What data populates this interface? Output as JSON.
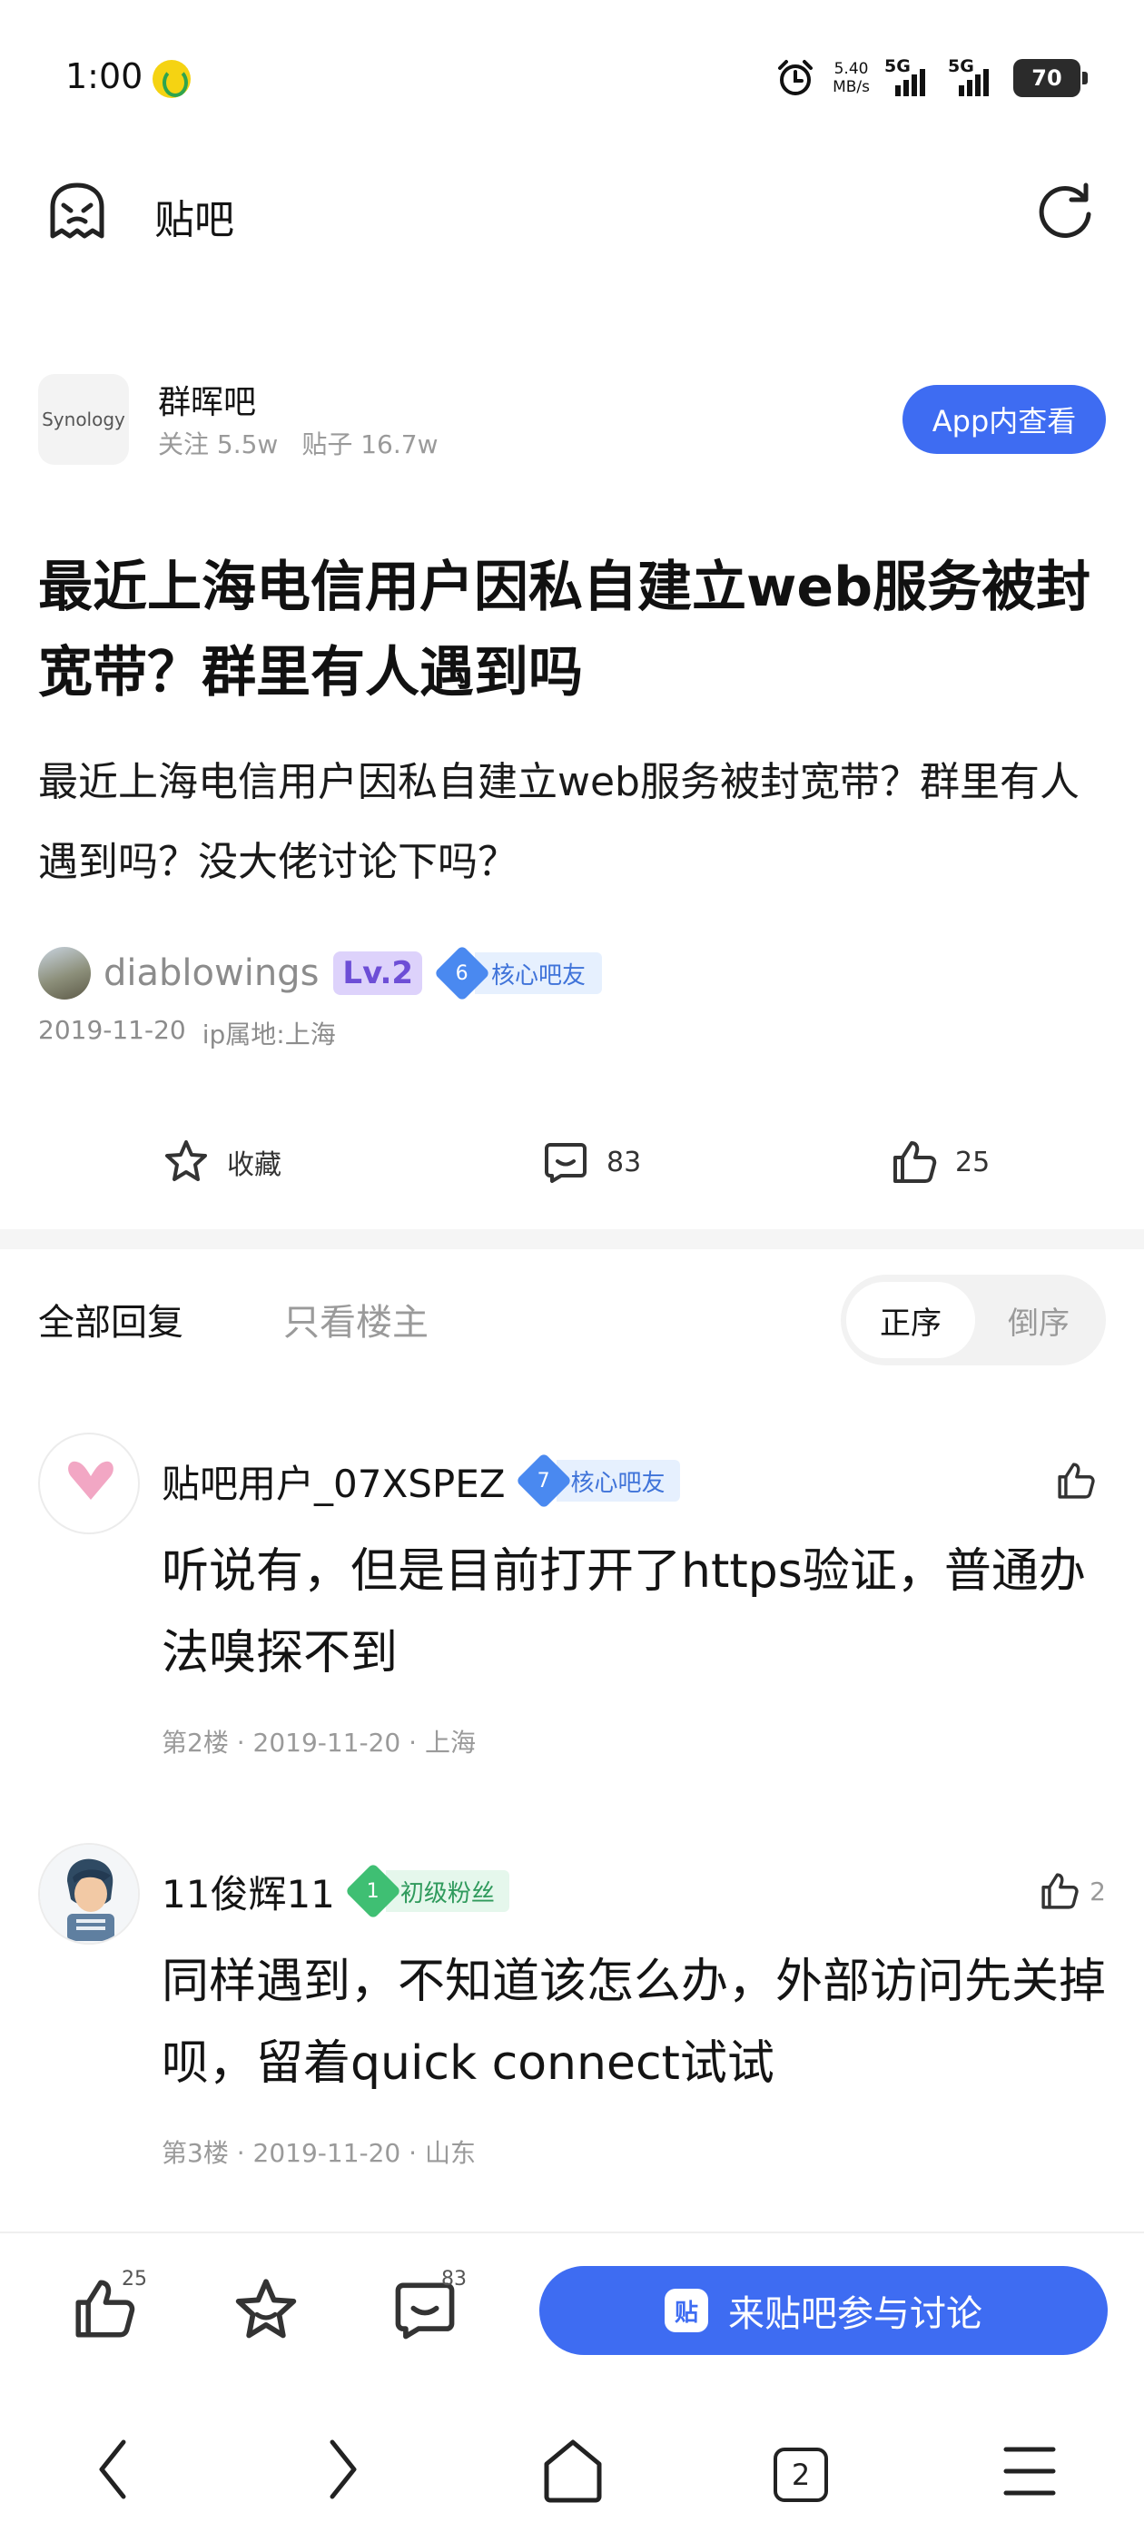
{
  "status_bar": {
    "time": "1:00",
    "speed_value": "5.40",
    "speed_unit": "MB/s",
    "net1": "5G",
    "net2": "5G",
    "battery": "70"
  },
  "header": {
    "title": "贴吧"
  },
  "forum": {
    "logo_text": "Synology",
    "name": "群晖吧",
    "followers": "关注 5.5w",
    "posts": "贴子 16.7w",
    "app_button": "App内查看"
  },
  "post": {
    "title": "最近上海电信用户因私自建立web服务被封宽带？群里有人遇到吗",
    "body": "最近上海电信用户因私自建立web服务被封宽带？群里有人遇到吗？没大佬讨论下吗？",
    "author": {
      "name": "diablowings",
      "level": "Lv.2",
      "badge_level": "6",
      "badge_text": "核心吧友"
    },
    "date": "2019-11-20",
    "location": "ip属地:上海",
    "actions": {
      "favorite_label": "收藏",
      "comments": "83",
      "likes": "25"
    }
  },
  "reply_tabs": {
    "all": "全部回复",
    "owner_only": "只看楼主",
    "sort_asc": "正序",
    "sort_desc": "倒序"
  },
  "replies": [
    {
      "user": "贴吧用户_07XSPEZ",
      "badge_level": "7",
      "badge_text": "核心吧友",
      "badge_color": "#4a89f0",
      "text": "听说有，但是目前打开了https验证，普通办法嗅探不到",
      "meta": "第2楼 · 2019-11-20 · 上海",
      "likes": ""
    },
    {
      "user": "11俊辉11",
      "badge_level": "1",
      "badge_text": "初级粉丝",
      "badge_color": "#3fbf73",
      "text": "同样遇到，不知道该怎么办，外部访问先关掉呗，留着quick connect试试",
      "meta": "第3楼 · 2019-11-20 · 山东",
      "likes": "2"
    }
  ],
  "bottom_bar": {
    "like_count": "25",
    "comment_count": "83",
    "discuss_button": "来贴吧参与讨论",
    "tieba_mark": "贴"
  },
  "nav": {
    "tab_count": "2"
  },
  "colors": {
    "accent": "#3e6cf2",
    "muted": "#9a9a9a"
  }
}
